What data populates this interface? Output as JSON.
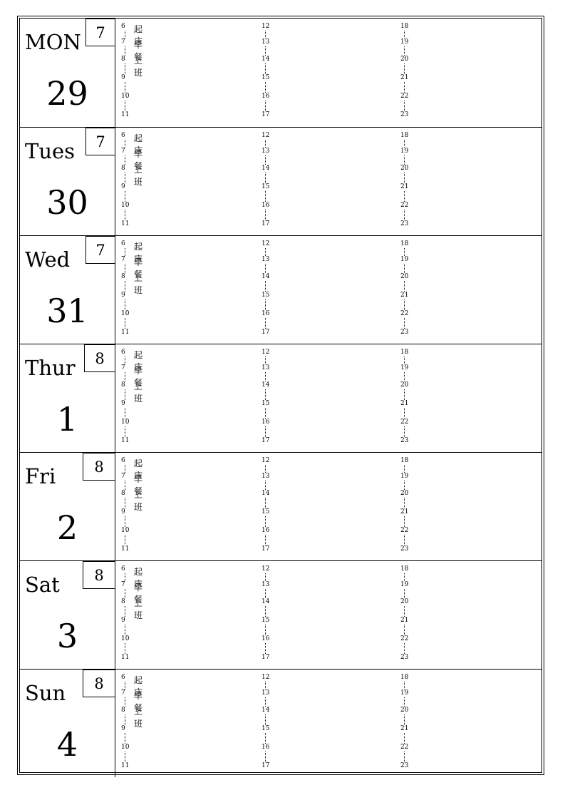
{
  "days": [
    {
      "name": "MON",
      "number": "29",
      "month": "7"
    },
    {
      "name": "Tues",
      "number": "30",
      "month": "7"
    },
    {
      "name": "Wed",
      "number": "31",
      "month": "7"
    },
    {
      "name": "Thur",
      "number": "1",
      "month": "8"
    },
    {
      "name": "Fri",
      "number": "2",
      "month": "8"
    },
    {
      "name": "Sat",
      "number": "3",
      "month": "8"
    },
    {
      "name": "Sun",
      "number": "4",
      "month": "8"
    }
  ],
  "hour_columns": [
    [
      "6",
      "7",
      "8",
      "9",
      "10",
      "11"
    ],
    [
      "12",
      "13",
      "14",
      "15",
      "16",
      "17"
    ],
    [
      "18",
      "19",
      "20",
      "21",
      "22",
      "23"
    ]
  ],
  "notes": [
    "起床",
    "早餐",
    "上班"
  ]
}
